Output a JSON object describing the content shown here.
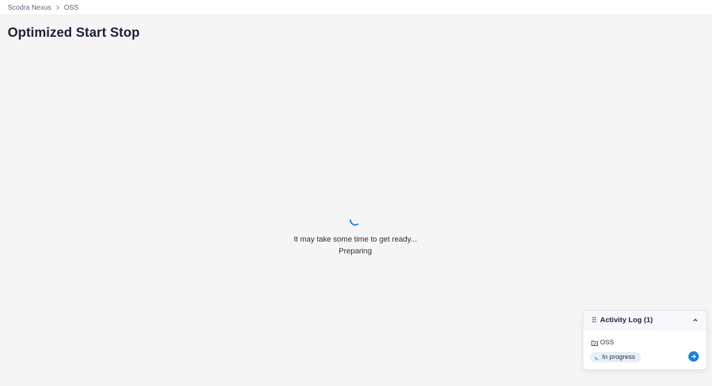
{
  "breadcrumb": {
    "items": [
      "Scodra Nexus",
      "OSS"
    ]
  },
  "page": {
    "title": "Optimized Start Stop"
  },
  "loader": {
    "message": "It may take some time to get ready...",
    "status": "Preparing"
  },
  "activity_log": {
    "title": "Activity Log (1)",
    "items": [
      {
        "name": "OSS",
        "status": "In progress"
      }
    ]
  },
  "colors": {
    "accent": "#1b7fe3",
    "background": "#f5f5f5",
    "status_pill_bg": "#e7eef8",
    "title_text": "#1c2237"
  },
  "icons": {
    "breadcrumb_separator": "chevron-right-icon",
    "loading": "loading-spinner-icon",
    "drag": "drag-handle-icon",
    "collapse": "chevron-up-icon",
    "folder": "folder-icon",
    "open": "arrow-right-icon"
  }
}
